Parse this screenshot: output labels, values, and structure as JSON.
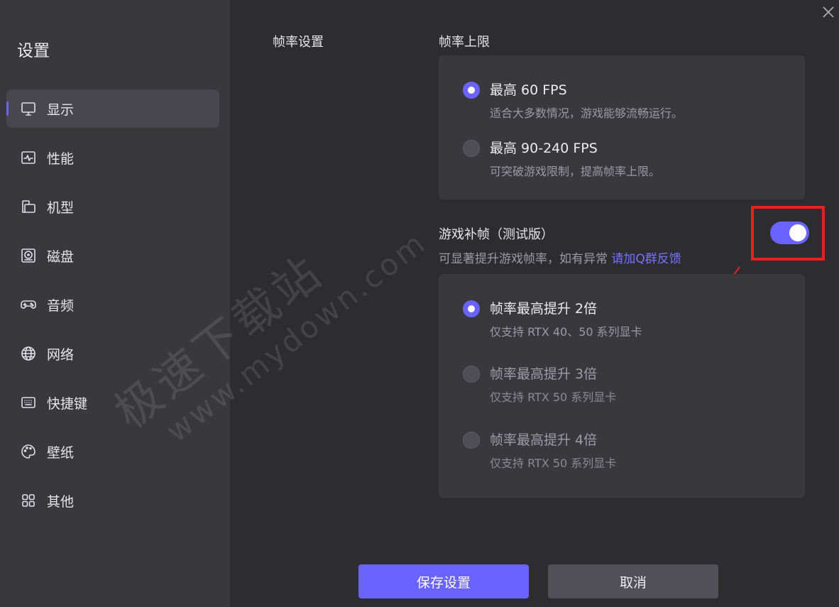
{
  "sidebar": {
    "title": "设置",
    "items": [
      {
        "label": "显示",
        "icon": "monitor-icon",
        "active": true
      },
      {
        "label": "性能",
        "icon": "performance-icon",
        "active": false
      },
      {
        "label": "机型",
        "icon": "device-icon",
        "active": false
      },
      {
        "label": "磁盘",
        "icon": "disk-icon",
        "active": false
      },
      {
        "label": "音频",
        "icon": "gamepad-icon",
        "active": false
      },
      {
        "label": "网络",
        "icon": "globe-icon",
        "active": false
      },
      {
        "label": "快捷键",
        "icon": "keyboard-icon",
        "active": false
      },
      {
        "label": "壁纸",
        "icon": "palette-icon",
        "active": false
      },
      {
        "label": "其他",
        "icon": "grid-icon",
        "active": false
      }
    ]
  },
  "main": {
    "section_label": "帧率设置",
    "fps_limit": {
      "label": "帧率上限",
      "options": [
        {
          "title": "最高 60 FPS",
          "desc": "适合大多数情况，游戏能够流畅运行。",
          "selected": true
        },
        {
          "title": "最高 90-240 FPS",
          "desc": "可突破游戏限制，提高帧率上限。",
          "selected": false
        }
      ]
    },
    "frame_gen": {
      "label": "游戏补帧（测试版）",
      "enabled": true,
      "hint": "可显著提升游戏帧率，如有异常",
      "hint_link": "请加Q群反馈",
      "options": [
        {
          "title": "帧率最高提升 2倍",
          "desc": "仅支持 RTX 40、50 系列显卡",
          "selected": true
        },
        {
          "title": "帧率最高提升 3倍",
          "desc": "仅支持 RTX 50 系列显卡",
          "selected": false
        },
        {
          "title": "帧率最高提升 4倍",
          "desc": "仅支持 RTX 50 系列显卡",
          "selected": false
        }
      ]
    }
  },
  "watermark": {
    "line1": "极速下载站",
    "line2": "www.mydown.com"
  },
  "buttons": {
    "save": "保存设置",
    "cancel": "取消"
  },
  "colors": {
    "accent": "#6b63ff",
    "highlight": "#e8211f",
    "sidebar_bg": "#38383d",
    "main_bg": "#2d2d31"
  }
}
